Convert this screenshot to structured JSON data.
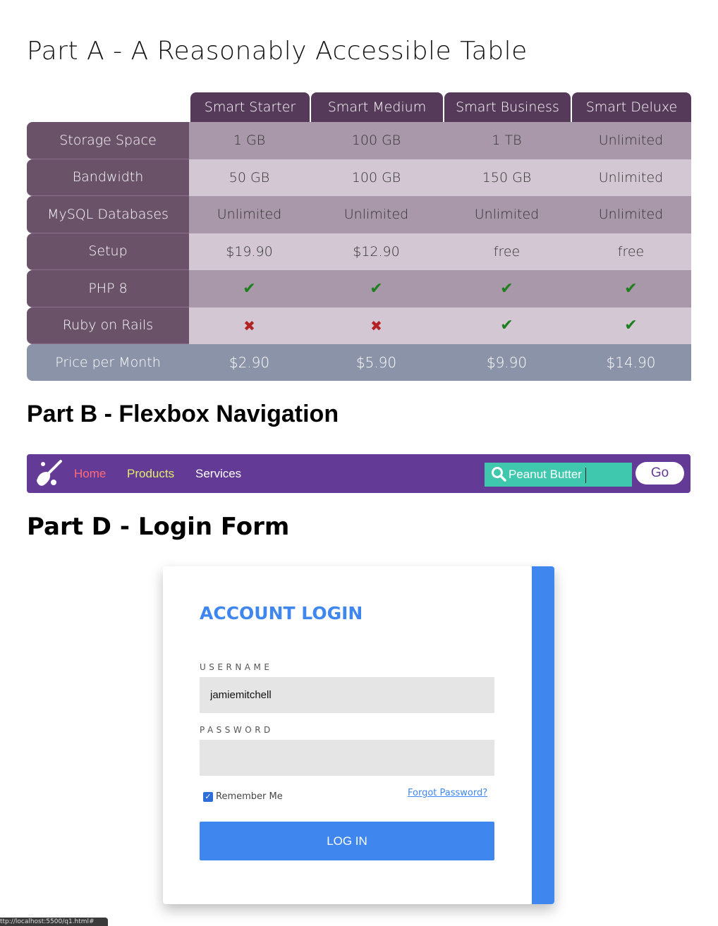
{
  "partA": {
    "title": "Part A - A Reasonably Accessible Table",
    "plans": [
      "Smart Starter",
      "Smart Medium",
      "Smart Business",
      "Smart Deluxe"
    ],
    "rows": [
      {
        "label": "Storage Space",
        "values": [
          "1 GB",
          "100 GB",
          "1 TB",
          "Unlimited"
        ]
      },
      {
        "label": "Bandwidth",
        "values": [
          "50 GB",
          "100 GB",
          "150 GB",
          "Unlimited"
        ]
      },
      {
        "label": "MySQL Databases",
        "values": [
          "Unlimited",
          "Unlimited",
          "Unlimited",
          "Unlimited"
        ]
      },
      {
        "label": "Setup",
        "values": [
          "$19.90",
          "$12.90",
          "free",
          "free"
        ]
      },
      {
        "label": "PHP 8",
        "values": [
          "check",
          "check",
          "check",
          "check"
        ]
      },
      {
        "label": "Ruby on Rails",
        "values": [
          "cross",
          "cross",
          "check",
          "check"
        ]
      }
    ],
    "footer": {
      "label": "Price per Month",
      "values": [
        "$2.90",
        "$5.90",
        "$9.90",
        "$14.90"
      ]
    }
  },
  "partB": {
    "title": "Part B - Flexbox Navigation",
    "nav": {
      "home": "Home",
      "products": "Products",
      "services": "Services"
    },
    "search": {
      "value": "Peanut Butter",
      "icon": "search-icon"
    },
    "go_label": "Go",
    "colors": {
      "bar": "#633a96",
      "home": "#ff6b7a",
      "products": "#e3ee6c",
      "search_bg": "#3fc8ae"
    }
  },
  "partD": {
    "title": "Part D - Login Form",
    "login": {
      "heading": "ACCOUNT LOGIN",
      "username_label": "USERNAME",
      "username_value": "jamiemitchell",
      "password_label": "PASSWORD",
      "password_value": "",
      "remember_label": "Remember Me",
      "remember_checked": true,
      "forgot_label": "Forgot Password?",
      "button_label": "LOG IN"
    },
    "colors": {
      "accent": "#3f87ee"
    }
  },
  "statusbar": {
    "url": "ttp://localhost:5500/q1.html#"
  }
}
